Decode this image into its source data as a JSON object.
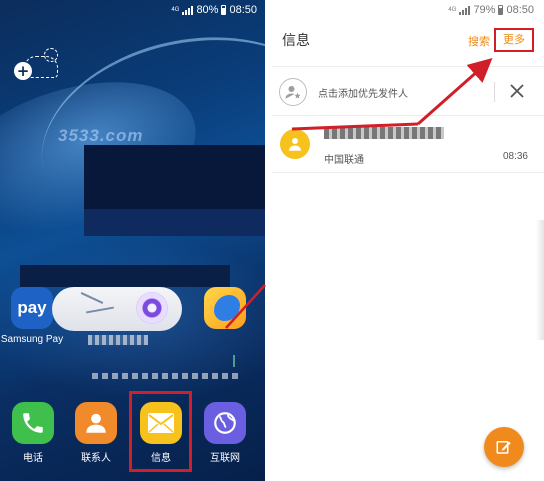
{
  "home": {
    "status": {
      "network": "4G",
      "battery": "80%",
      "time": "08:50"
    },
    "watermark": "3533.com",
    "apps": {
      "pay_icon_text": "pay",
      "pay_label": "Samsung Pay",
      "phone_label": "电话",
      "contacts_label": "联系人",
      "messages_label": "信息",
      "internet_label": "互联网"
    }
  },
  "messages": {
    "status": {
      "network": "4G",
      "battery": "79%",
      "time": "08:50"
    },
    "title": "信息",
    "search_label": "搜索",
    "more_label": "更多",
    "priority_label": "点击添加优先发件人",
    "thread": {
      "sender": "中国联通",
      "time": "08:36"
    }
  },
  "colors": {
    "accent_orange": "#ef8b16",
    "highlight_red": "#d11f2a",
    "messages_yellow": "#f6c21b"
  }
}
